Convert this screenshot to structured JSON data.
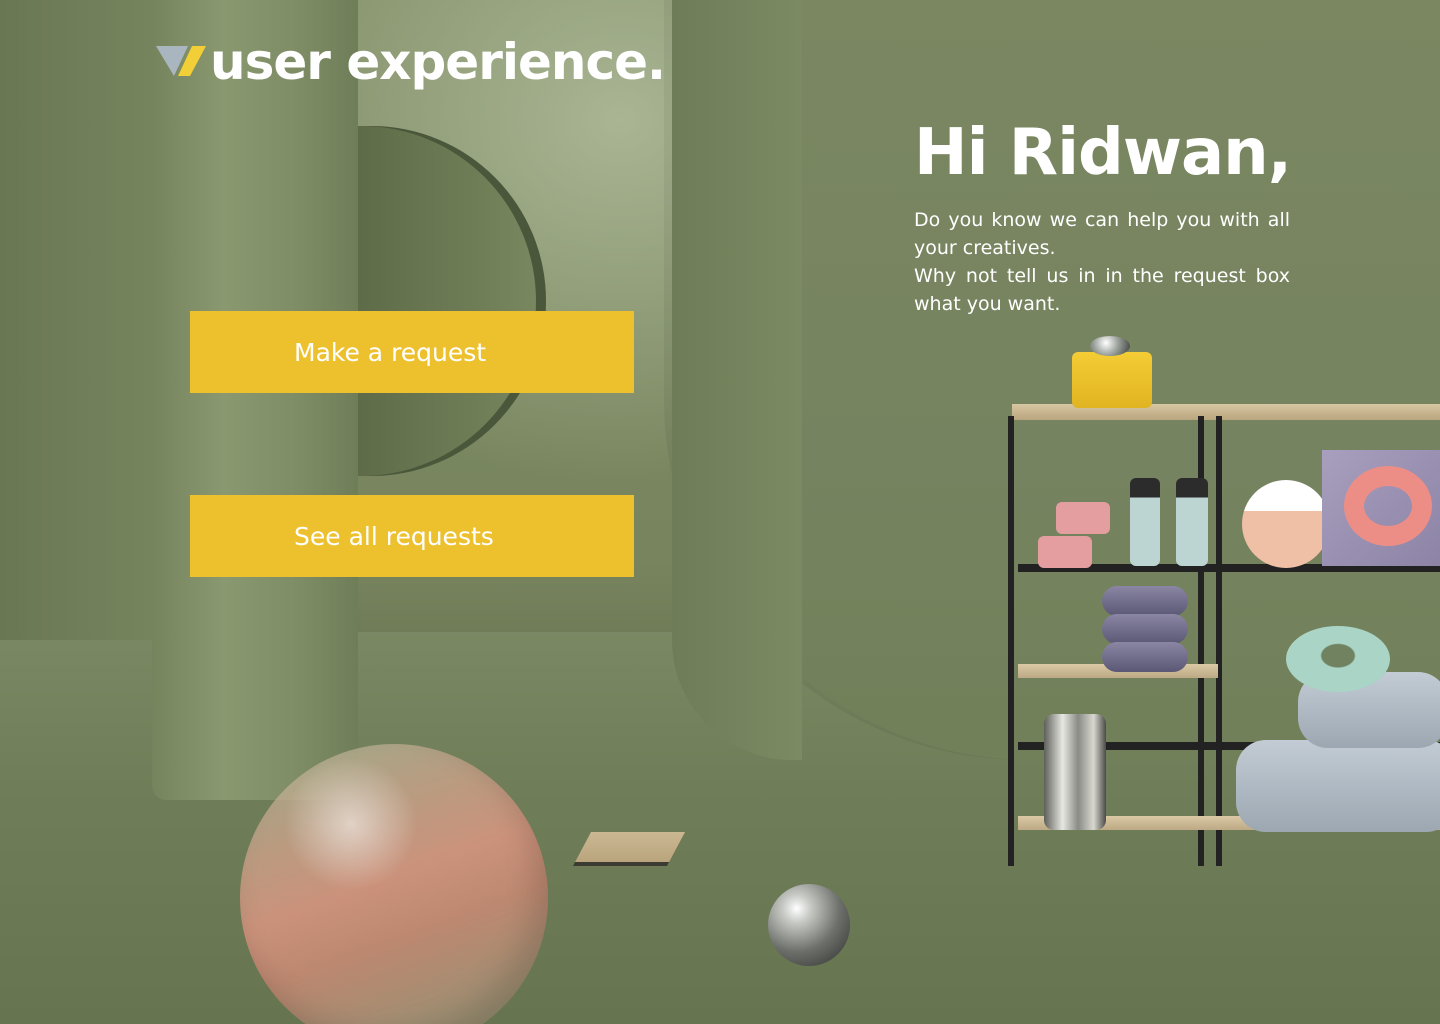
{
  "brand": {
    "logo_text": "user experience.",
    "logo_icon": "triangle-logo-icon",
    "colors": {
      "logo_grey": "#a9b6c0",
      "logo_yellow": "#f2cf37"
    }
  },
  "actions": {
    "make_request_label": "Make a request",
    "see_requests_label": "See all requests",
    "button_color": "#edc02e"
  },
  "greeting": {
    "title": "Hi Ridwan,",
    "line1": "Do you know we can help you with all your creatives.",
    "line2": "Why not tell us in in the request box what you want."
  }
}
